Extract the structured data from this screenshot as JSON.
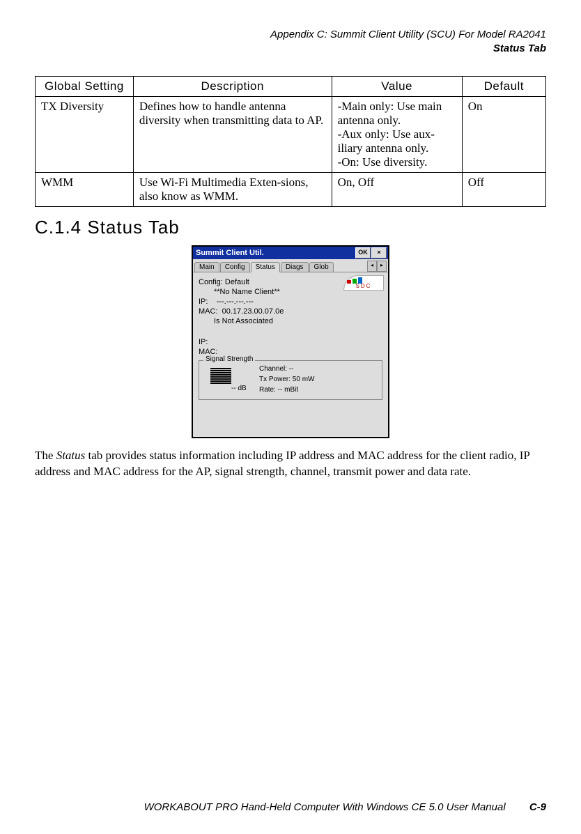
{
  "header": {
    "line1": "Appendix  C:  Summit Client Utility (SCU) For Model RA2041",
    "line2": "Status Tab"
  },
  "table": {
    "headers": {
      "col1": "Global Setting",
      "col2": "Description",
      "col3": "Value",
      "col4": "Default"
    },
    "rows": [
      {
        "setting": "TX Diversity",
        "description": "Defines how to handle antenna diversity when transmitting data to AP.",
        "value": "-Main only: Use main antenna only.\n-Aux only: Use aux-iliary antenna only.\n-On: Use diversity.",
        "default": "On"
      },
      {
        "setting": "WMM",
        "description": "Use Wi-Fi Multimedia Exten-sions, also know as WMM.",
        "value": "On, Off",
        "default": "Off"
      }
    ]
  },
  "section_heading": "C.1.4  Status Tab",
  "window": {
    "title": "Summit Client Util.",
    "ok_btn": "OK",
    "close_btn": "×",
    "tabs": {
      "main": "Main",
      "config": "Config",
      "status": "Status",
      "diags": "Diags",
      "glob": "Glob"
    },
    "logo_text": "SDC",
    "content": {
      "config_line": "Config: Default",
      "client_line": "**No Name Client**",
      "ip1_label": "IP:",
      "ip1_value": "---.---.---.---",
      "mac1_label": "MAC:",
      "mac1_value": "00.17.23.00.07.0e",
      "assoc_line": "Is Not Associated",
      "ip2_label": "IP:",
      "mac2_label": "MAC:",
      "signal_legend": "Signal Strength",
      "db_label": "-- dB",
      "channel": "Channel: --",
      "txpower": "Tx Power: 50 mW",
      "rate": "Rate: -- mBit"
    }
  },
  "paragraph": "The Status tab provides status information including IP address and MAC address for the client radio, IP address and MAC address for the AP, signal strength, channel, transmit power and data rate.",
  "paragraph_prefix": "The ",
  "paragraph_italic": "Status",
  "paragraph_suffix": " tab provides status information including IP address and MAC address for the client radio, IP address and MAC address for the AP, signal strength, channel, transmit power and data rate.",
  "footer": {
    "booktitle": "WORKABOUT PRO Hand-Held Computer With Windows CE 5.0 User Manual",
    "pagenum": "C-9"
  }
}
